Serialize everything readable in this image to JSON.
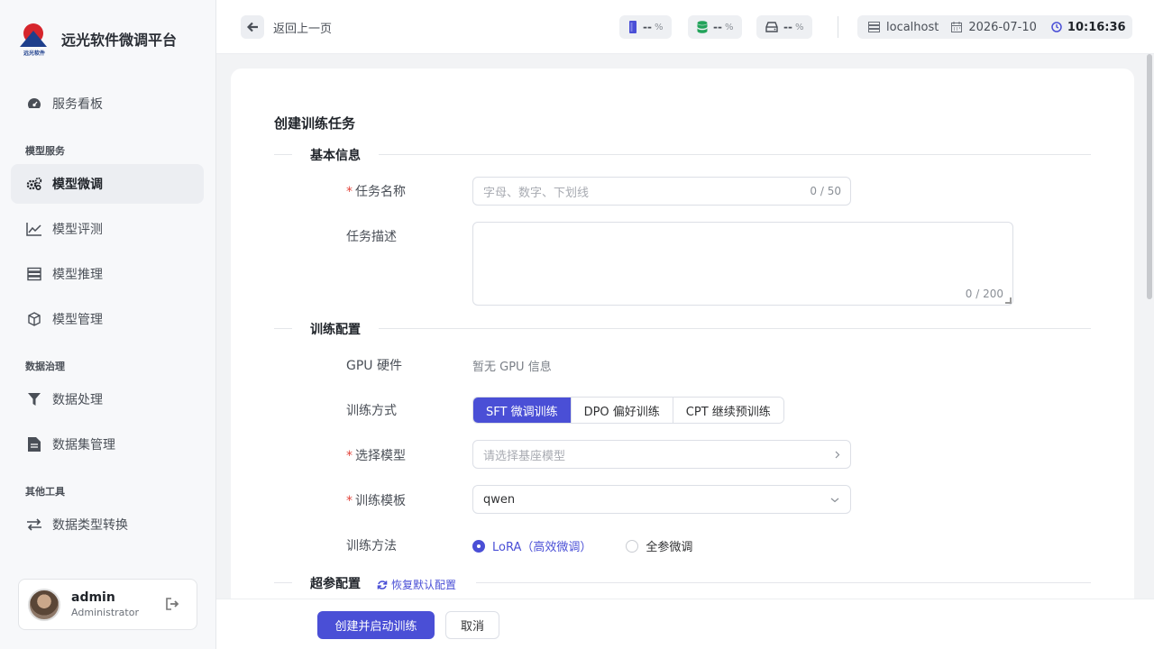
{
  "app": {
    "title": "远光软件微调平台",
    "logo_caption": "远光软件"
  },
  "sidebar": {
    "items": [
      {
        "label": "服务看板",
        "icon": "gauge-icon"
      },
      {
        "section": "模型服务"
      },
      {
        "label": "模型微调",
        "icon": "gears-icon",
        "active": true
      },
      {
        "label": "模型评测",
        "icon": "line-chart-icon"
      },
      {
        "label": "模型推理",
        "icon": "server-icon"
      },
      {
        "label": "模型管理",
        "icon": "cube-icon"
      },
      {
        "section": "数据治理"
      },
      {
        "label": "数据处理",
        "icon": "filter-icon"
      },
      {
        "label": "数据集管理",
        "icon": "file-icon"
      },
      {
        "section": "其他工具"
      },
      {
        "label": "数据类型转换",
        "icon": "swap-icon"
      }
    ],
    "sections": {
      "model_service": "模型服务",
      "data_governance": "数据治理",
      "other_tools": "其他工具"
    },
    "nav": {
      "dashboard": "服务看板",
      "finetune": "模型微调",
      "evaluate": "模型评测",
      "inference": "模型推理",
      "manage": "模型管理",
      "data_process": "数据处理",
      "dataset_manage": "数据集管理",
      "convert": "数据类型转换"
    },
    "user": {
      "name": "admin",
      "role": "Administrator"
    }
  },
  "topbar": {
    "back_label": "返回上一页",
    "stats": [
      {
        "icon": "memory-icon",
        "value": "--",
        "unit": "%"
      },
      {
        "icon": "database-icon",
        "value": "--",
        "unit": "%"
      },
      {
        "icon": "disk-icon",
        "value": "--",
        "unit": "%"
      }
    ],
    "host": "localhost",
    "date": "2026-07-10",
    "time": "10:16:36"
  },
  "form": {
    "page_title": "创建训练任务",
    "sections": {
      "basic": "基本信息",
      "training": "训练配置",
      "hyper": "超参配置"
    },
    "task_name": {
      "label": "任务名称",
      "placeholder": "字母、数字、下划线",
      "count": "0 / 50"
    },
    "task_desc": {
      "label": "任务描述",
      "count": "0 / 200"
    },
    "gpu": {
      "label": "GPU 硬件",
      "value": "暂无 GPU 信息"
    },
    "train_mode": {
      "label": "训练方式",
      "options": [
        "SFT 微调训练",
        "DPO 偏好训练",
        "CPT 继续预训练"
      ],
      "selected": "SFT 微调训练"
    },
    "model": {
      "label": "选择模型",
      "placeholder": "请选择基座模型"
    },
    "template": {
      "label": "训练模板",
      "value": "qwen"
    },
    "method": {
      "label": "训练方法",
      "options": [
        "LoRA（高效微调）",
        "全参微调"
      ],
      "selected": "LoRA（高效微调）"
    },
    "reset_label": "恢复默认配置"
  },
  "actions": {
    "submit": "创建并启动训练",
    "cancel": "取消"
  },
  "colors": {
    "accent": "#4a4fd6",
    "required": "#e2453c"
  }
}
